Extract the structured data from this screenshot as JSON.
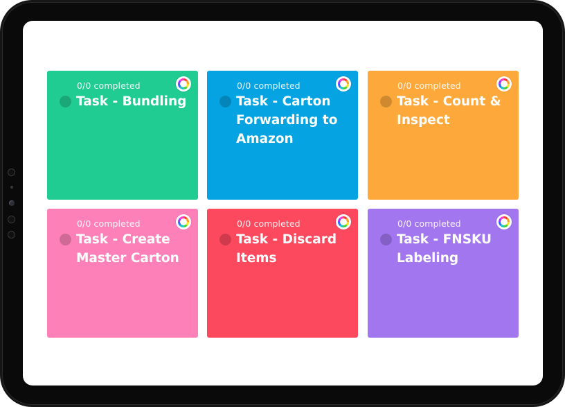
{
  "colors": {
    "bezel": "#161616",
    "screen": "#ffffff"
  },
  "tasks": [
    {
      "progress": "0/0 completed",
      "title": "Task - Bundling",
      "color": "#21cc93",
      "icon": "color-wheel-icon"
    },
    {
      "progress": "0/0 completed",
      "title": "Task - Carton Forwarding to Amazon",
      "color": "#05a3e2",
      "icon": "color-wheel-icon"
    },
    {
      "progress": "0/0 completed",
      "title": "Task - Count & Inspect",
      "color": "#fda83a",
      "icon": "color-wheel-icon"
    },
    {
      "progress": "0/0 completed",
      "title": "Task - Create Master Carton",
      "color": "#fd80b8",
      "icon": "color-wheel-icon"
    },
    {
      "progress": "0/0 completed",
      "title": "Task - Discard Items",
      "color": "#fd495e",
      "icon": "color-wheel-icon"
    },
    {
      "progress": "0/0 completed",
      "title": "Task - FNSKU Labeling",
      "color": "#a176ef",
      "icon": "color-wheel-icon"
    }
  ]
}
